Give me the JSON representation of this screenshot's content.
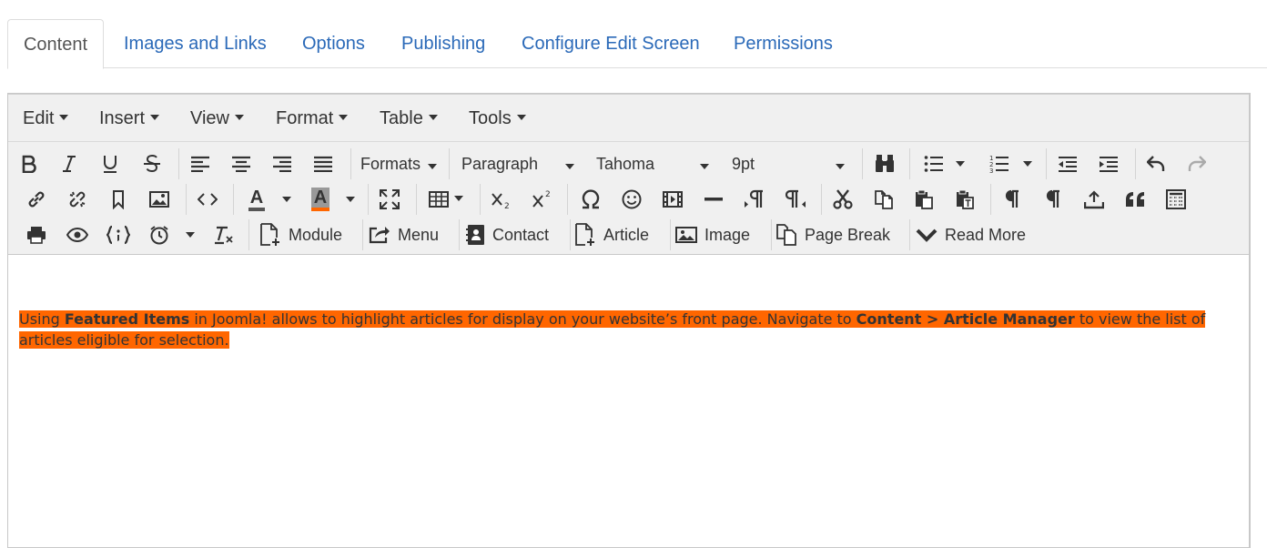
{
  "tabs": [
    {
      "label": "Content",
      "active": true
    },
    {
      "label": "Images and Links"
    },
    {
      "label": "Options"
    },
    {
      "label": "Publishing"
    },
    {
      "label": "Configure Edit Screen"
    },
    {
      "label": "Permissions"
    }
  ],
  "menubar": {
    "edit": "Edit",
    "insert": "Insert",
    "view": "View",
    "format": "Format",
    "table": "Table",
    "tools": "Tools"
  },
  "toolbar": {
    "formats": "Formats",
    "block": "Paragraph",
    "font_family": "Tahoma",
    "font_size": "9pt",
    "module": "Module",
    "menu": "Menu",
    "contact": "Contact",
    "article": "Article",
    "image": "Image",
    "page_break": "Page Break",
    "read_more": "Read More",
    "text_color_letter": "A",
    "bg_color_letter": "A",
    "text_color": "#555555",
    "bg_color": "#ff6600"
  },
  "content": {
    "t1": "Using ",
    "b1": "Featured Items",
    "t2": " in Joomla! allows to highlight articles for display on your website’s front page. Navigate to ",
    "b2": "Content > Article Manager",
    "t3": " to view the list of articles eligible for selection.",
    "highlight_color": "#ff6600"
  }
}
